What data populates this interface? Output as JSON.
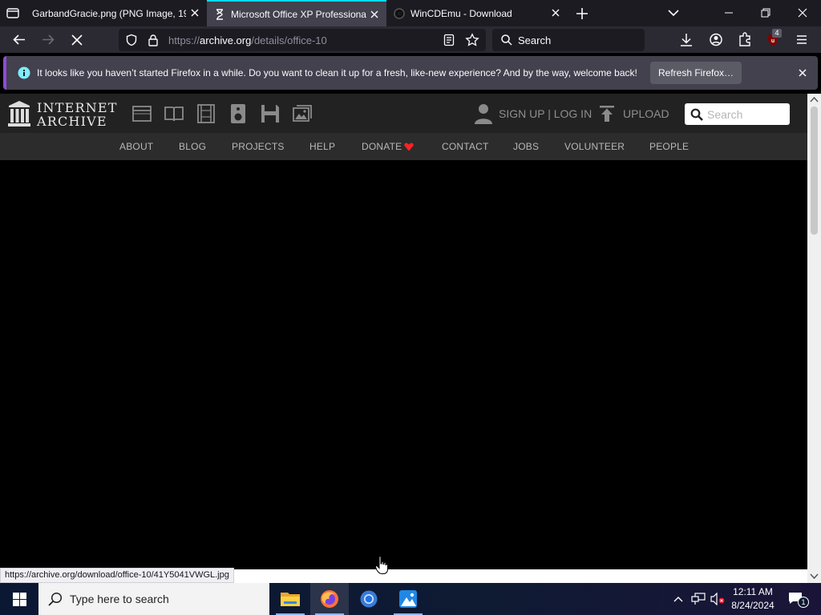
{
  "tabs": [
    {
      "title": "GarbandGracie.png (PNG Image, 19"
    },
    {
      "title": "Microsoft Office XP Professiona"
    },
    {
      "title": "WinCDEmu - Download"
    }
  ],
  "navbar": {
    "url_prefix": "https://",
    "url_host": "archive.org",
    "url_path": "/details/office-10",
    "search_placeholder": "Search",
    "extension_badge": "4"
  },
  "notification": {
    "message": "It looks like you haven’t started Firefox in a while. Do you want to clean it up for a fresh, like-new experience? And by the way, welcome back!",
    "button": "Refresh Firefox…"
  },
  "ia_header": {
    "logo_line1": "INTERNET",
    "logo_line2": "ARCHIVE",
    "signup": "SIGN UP | LOG IN",
    "upload": "UPLOAD",
    "search_placeholder": "Search"
  },
  "ia_nav": [
    "ABOUT",
    "BLOG",
    "PROJECTS",
    "HELP",
    "DONATE",
    "CONTACT",
    "JOBS",
    "VOLUNTEER",
    "PEOPLE"
  ],
  "status_link": "https://archive.org/download/office-10/41Y5041VWGL.jpg",
  "taskbar": {
    "search_placeholder": "Type here to search",
    "time": "12:11 AM",
    "date": "8/24/2024",
    "notification_count": "1"
  },
  "colors": {
    "accent": "#00ddff",
    "notice_border": "#8d4bd6",
    "donate_heart": "#ff2222"
  }
}
